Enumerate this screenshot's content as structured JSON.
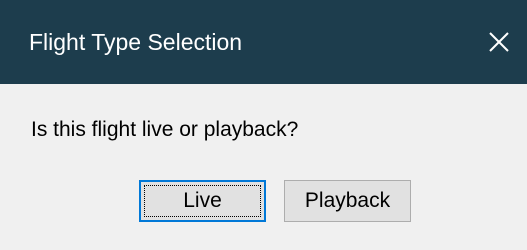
{
  "window": {
    "title": "Flight Type Selection",
    "close_icon": "close-icon",
    "titlebar_color": "#1d3d4d"
  },
  "dialog": {
    "prompt": "Is this flight live or playback?",
    "buttons": [
      {
        "label": "Live",
        "focused": true
      },
      {
        "label": "Playback",
        "focused": false
      }
    ],
    "accent_color": "#0078d7"
  }
}
